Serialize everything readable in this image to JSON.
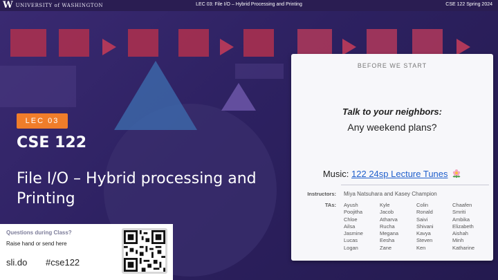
{
  "header": {
    "logo_w": "W",
    "logo_text": "UNIVERSITY of WASHINGTON",
    "center": "LEC 03: File I/O – Hybrid Processing and Printing",
    "right": "CSE 122 Spring 2024"
  },
  "main": {
    "lecture_tag": "LEC 03",
    "course": "CSE 122",
    "title": "File I/O – Hybrid processing and Printing"
  },
  "questions": {
    "title": "Questions during Class?",
    "subtitle": "Raise hand or send here",
    "site": "sli.do",
    "hashtag": "#cse122"
  },
  "card": {
    "heading": "BEFORE WE START",
    "prompt": "Talk to your neighbors:",
    "question": "Any weekend plans?",
    "music_label": "Music: ",
    "music_link": "122 24sp Lecture Tunes",
    "instructors_label": "Instructors:",
    "instructors": "Miya Natsuhara and Kasey Champion",
    "tas_label": "TAs:",
    "ta_columns": [
      [
        "Ayush",
        "Poojitha",
        "Chloe",
        "Ailsa",
        "Jasmine",
        "Lucas",
        "Logan"
      ],
      [
        "Kyle",
        "Jacob",
        "Atharva",
        "Rucha",
        "Megana",
        "Eesha",
        "Zane"
      ],
      [
        "Colin",
        "Ronald",
        "Saivi",
        "Shivani",
        "Kavya",
        "Steven",
        "Ken"
      ],
      [
        "Chaafen",
        "Smriti",
        "Ambika",
        "Elizabeth",
        "Aishah",
        "Minh",
        "Katharine"
      ]
    ]
  },
  "colors": {
    "background": "#2d2161",
    "accent_orange": "#f07d2a",
    "accent_red": "#a8304f",
    "link_blue": "#1f5fcc"
  },
  "icons": [
    "flower-icon",
    "qr-code-icon",
    "uw-logo-icon"
  ]
}
